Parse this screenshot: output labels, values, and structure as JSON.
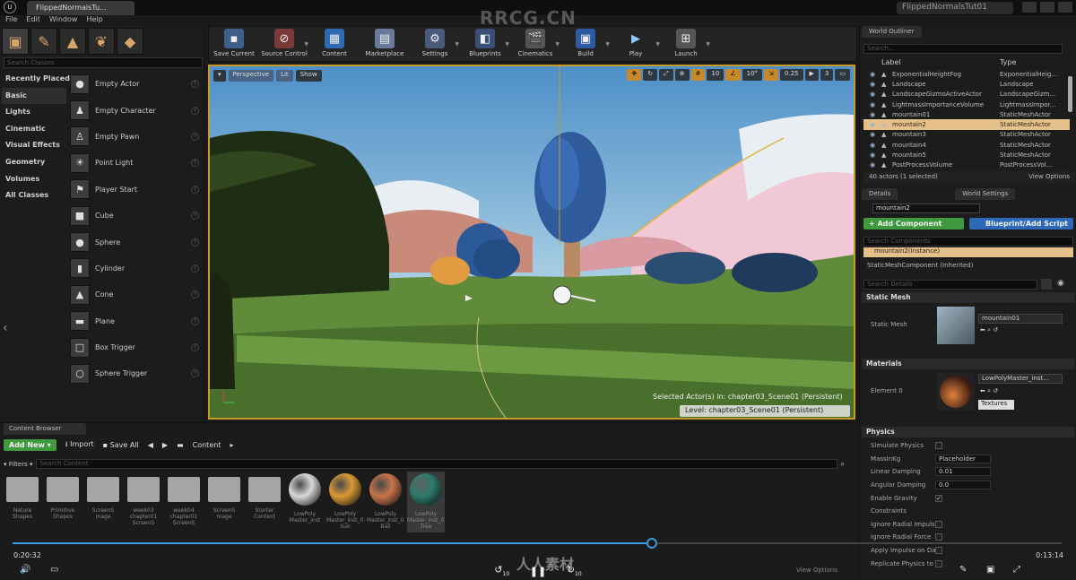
{
  "window": {
    "doc_tab": "FlippedNormalsTu...",
    "project_title": "FlippedNormalsTut01"
  },
  "menu": [
    "File",
    "Edit",
    "Window",
    "Help"
  ],
  "modes": {
    "search_placeholder": "Search Classes",
    "categories": [
      "Recently Placed",
      "Basic",
      "Lights",
      "Cinematic",
      "Visual Effects",
      "Geometry",
      "Volumes",
      "All Classes"
    ],
    "selected_category": "Basic",
    "actors": [
      "Empty Actor",
      "Empty Character",
      "Empty Pawn",
      "Point Light",
      "Player Start",
      "Cube",
      "Sphere",
      "Cylinder",
      "Cone",
      "Plane",
      "Box Trigger",
      "Sphere Trigger"
    ]
  },
  "toolbar": {
    "buttons": [
      {
        "label": "Save Current",
        "icon": "save-icon"
      },
      {
        "label": "Source Control",
        "icon": "source-control-icon"
      },
      {
        "label": "Content",
        "icon": "content-icon"
      },
      {
        "label": "Marketplace",
        "icon": "marketplace-icon"
      },
      {
        "label": "Settings",
        "icon": "settings-icon"
      },
      {
        "label": "Blueprints",
        "icon": "blueprints-icon"
      },
      {
        "label": "Cinematics",
        "icon": "cinematics-icon"
      },
      {
        "label": "Build",
        "icon": "build-icon"
      },
      {
        "label": "Play",
        "icon": "play-icon"
      },
      {
        "label": "Launch",
        "icon": "launch-icon"
      }
    ]
  },
  "viewport": {
    "perspective": "Perspective",
    "lit": "Lit",
    "show": "Show",
    "snap_grid": "10",
    "snap_angle": "10°",
    "snap_scale": "0.25",
    "camera_speed": "3",
    "selected_actors": "Selected Actor(s) in: chapter03_Scene01 (Persistent)",
    "level": "Level: chapter03_Scene01 (Persistent)"
  },
  "outliner": {
    "tab": "World Outliner",
    "search_placeholder": "Search...",
    "col_label": "Label",
    "col_type": "Type",
    "rows": [
      {
        "label": "ExponentialHeightFog",
        "type": "ExponentialHeig..."
      },
      {
        "label": "Landscape",
        "type": "Landscape"
      },
      {
        "label": "LandscapeGizmoActiveActor",
        "type": "LandscapeGizm..."
      },
      {
        "label": "LightmassImportanceVolume",
        "type": "LightmassImpor..."
      },
      {
        "label": "mountain01",
        "type": "StaticMeshActor"
      },
      {
        "label": "mountain2",
        "type": "StaticMeshActor"
      },
      {
        "label": "mountain3",
        "type": "StaticMeshActor"
      },
      {
        "label": "mountain4",
        "type": "StaticMeshActor"
      },
      {
        "label": "mountain5",
        "type": "StaticMeshActor"
      },
      {
        "label": "PostProcessVolume",
        "type": "PostProcessVol..."
      }
    ],
    "selected_row": 5,
    "footer": "40 actors (1 selected)",
    "view_options": "View Options"
  },
  "details": {
    "tab": "Details",
    "tab2": "World Settings",
    "actor_name": "mountain2",
    "add_component": "+ Add Component",
    "blueprint_btn": "Blueprint/Add Script",
    "search_components": "Search Components",
    "instance": "mountain2(Instance)",
    "component": "StaticMeshComponent (Inherited)",
    "search_details": "Search Details",
    "static_mesh_section": "Static Mesh",
    "static_mesh_label": "Static Mesh",
    "static_mesh_value": "mountain01",
    "materials_section": "Materials",
    "element_label": "Element 0",
    "element_value": "LowPolyMaster_inst...",
    "textures": "Textures",
    "physics_section": "Physics",
    "physics": [
      {
        "label": "Simulate Physics",
        "kind": "check",
        "value": ""
      },
      {
        "label": "MassInKg",
        "kind": "field",
        "value": "Placeholder"
      },
      {
        "label": "Linear Damping",
        "kind": "field",
        "value": "0.01"
      },
      {
        "label": "Angular Damping",
        "kind": "field",
        "value": "0.0"
      },
      {
        "label": "Enable Gravity",
        "kind": "check",
        "value": "✓"
      },
      {
        "label": "Constraints",
        "kind": "none",
        "value": ""
      },
      {
        "label": "Ignore Radial Impulse",
        "kind": "check",
        "value": ""
      },
      {
        "label": "Ignore Radial Force",
        "kind": "check",
        "value": ""
      },
      {
        "label": "Apply Impulse on Dam",
        "kind": "check",
        "value": ""
      },
      {
        "label": "Replicate Physics to A",
        "kind": "check",
        "value": ""
      }
    ]
  },
  "content_browser": {
    "tab": "Content Browser",
    "add_new": "Add New",
    "import": "Import",
    "save_all": "Save All",
    "path": "Content",
    "filters": "Filters",
    "search_placeholder": "Search Content",
    "view_options": "View Options",
    "assets": [
      {
        "label": "Nature Shapes",
        "kind": "folder",
        "color": ""
      },
      {
        "label": "Primitive Shapes",
        "kind": "folder",
        "color": ""
      },
      {
        "label": "ScreenS mage",
        "kind": "folder",
        "color": ""
      },
      {
        "label": "week03 chapter01 ScreenS",
        "kind": "folder",
        "color": ""
      },
      {
        "label": "week04 chapter01 ScreenS",
        "kind": "folder",
        "color": ""
      },
      {
        "label": "ScreenS mage",
        "kind": "folder",
        "color": ""
      },
      {
        "label": "Starter Content",
        "kind": "folder",
        "color": ""
      },
      {
        "label": "LowPoly Master_inst",
        "kind": "sphere",
        "color": "#d8d8d8"
      },
      {
        "label": "LowPoly Master_inst_03 Sun",
        "kind": "sphere",
        "color": "#d99a33"
      },
      {
        "label": "LowPoly Master_inst_03 Ball",
        "kind": "sphere",
        "color": "#c8744a"
      },
      {
        "label": "LowPoly Master_inst_03 Tree",
        "kind": "sphere",
        "color": "#2d7a6a"
      }
    ]
  },
  "player": {
    "elapsed": "0:20:32",
    "total": "0:13:14",
    "progress": 0.609,
    "skip_back": "10",
    "skip_fwd": "10"
  },
  "watermarks": {
    "top": "RRCG.CN",
    "bottom": "人人素材"
  },
  "colors": {
    "accent": "#c79b2a",
    "selection": "#e6c08a",
    "green": "#3f9a3f",
    "blue": "#2e69b8",
    "progress": "#3b9ae0"
  }
}
